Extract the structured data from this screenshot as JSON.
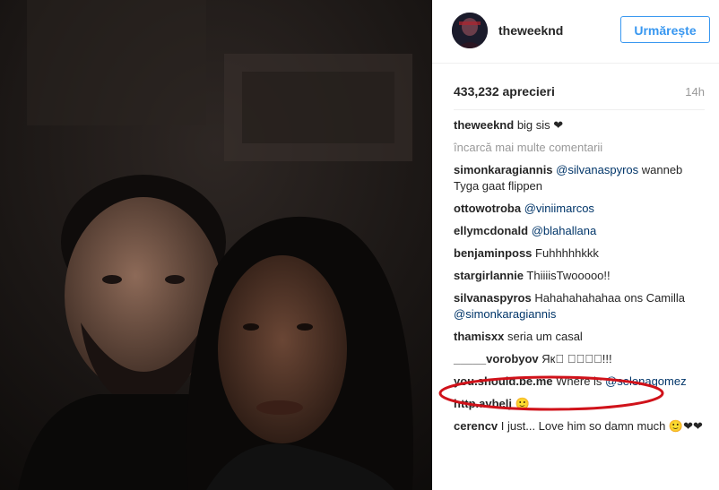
{
  "header": {
    "username": "theweeknd",
    "follow_label": "Urmărește"
  },
  "post": {
    "likes": "433,232 aprecieri",
    "time": "14h"
  },
  "caption": {
    "user": "theweeknd",
    "text": "big sis ❤"
  },
  "load_more": "încarcă mai multe comentarii",
  "comments": [
    {
      "user": "simonkaragiannis",
      "mention": "@silvanaspyros",
      "text": "wanneb Tyga gaat flippen",
      "after": ""
    },
    {
      "user": "ottowotroba",
      "mention": "@viniimarcos",
      "text": "",
      "after": ""
    },
    {
      "user": "ellymcdonald",
      "mention": "@blahallana",
      "text": "",
      "after": ""
    },
    {
      "user": "benjaminposs",
      "mention": "",
      "text": "Fuhhhhhkkk",
      "after": ""
    },
    {
      "user": "stargirlannie",
      "mention": "",
      "text": "ThiiiisTwooooo!!",
      "after": ""
    },
    {
      "user": "silvanaspyros",
      "mention": "",
      "text": "Hahahahahahaa ons Camilla",
      "after": "@simonkaragiannis"
    },
    {
      "user": "thamisxx",
      "mention": "",
      "text": "seria um casal",
      "after": ""
    },
    {
      "user": "_____vorobyov",
      "mention": "",
      "text": "Як\u0000 \u0000\u0000\u0000\u0000!!!",
      "after": ""
    },
    {
      "user": "you.should.be.me",
      "mention": "",
      "text": "Where is",
      "after": "@selenagomez"
    },
    {
      "user": "http.avbelj",
      "mention": "",
      "text": "🙂",
      "after": ""
    },
    {
      "user": "cerencv",
      "mention": "",
      "text": "I just... Love him so damn much 🙂❤❤",
      "after": ""
    }
  ],
  "colors": {
    "accent": "#3897f0",
    "mention": "#003569",
    "annotation": "#d0121a"
  },
  "icons": {
    "annotation": "red-oval-highlight"
  }
}
